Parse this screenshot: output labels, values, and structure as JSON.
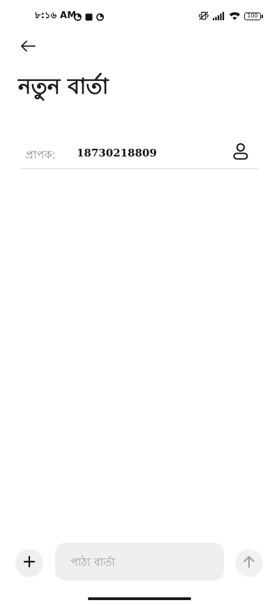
{
  "status_bar": {
    "time": "৮:১৬ AM",
    "battery_level": "100",
    "icons": [
      "data-saver-icon",
      "square-notification-icon",
      "data-saver-icon",
      "vibrate-icon",
      "signal-icon",
      "wifi-icon",
      "battery-icon"
    ]
  },
  "header": {
    "back_icon": "arrow-left-icon",
    "title": "নতুন বার্তা"
  },
  "recipient": {
    "label": "প্রাপক:",
    "value": "18730218809",
    "contact_icon": "person-icon"
  },
  "composer": {
    "add_icon": "plus-icon",
    "placeholder": "পাঠ্য বার্তা",
    "value": "",
    "send_icon": "arrow-up-icon"
  },
  "colors": {
    "background": "#ffffff",
    "input_background": "#efefef",
    "placeholder": "#9a9a9a",
    "label": "#8a8a8a",
    "divider": "#d9d9d9"
  }
}
